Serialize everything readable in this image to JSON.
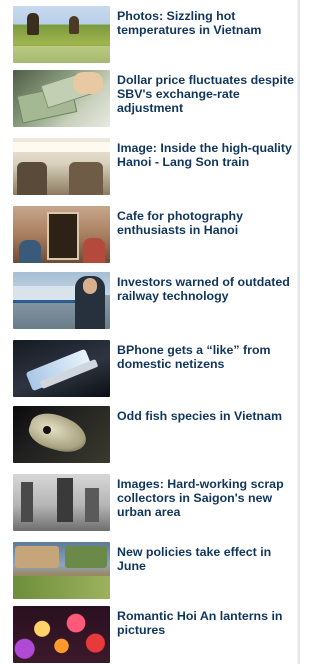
{
  "news": {
    "items": [
      {
        "title": "Photos: Sizzling hot temperatures in Vietnam",
        "thumbnail": "hot-weather-street-photo"
      },
      {
        "title": "Dollar price fluctuates despite SBV's exchange-rate adjustment",
        "thumbnail": "dollar-banknotes-photo"
      },
      {
        "title": "Image: Inside the high-quality Hanoi - Lang Son train",
        "thumbnail": "train-interior-photo"
      },
      {
        "title": "Cafe for photography enthusiasts in Hanoi",
        "thumbnail": "cafe-interior-photo"
      },
      {
        "title": "Investors warned of outdated railway technology",
        "thumbnail": "railway-station-speaker-photo"
      },
      {
        "title": "BPhone gets a “like” from domestic netizens",
        "thumbnail": "smartphone-photo"
      },
      {
        "title": "Odd fish species in Vietnam",
        "thumbnail": "fish-closeup-photo"
      },
      {
        "title": "Images: Hard-working scrap collectors in Saigon's new urban area",
        "thumbnail": "urban-area-photo"
      },
      {
        "title": "New policies take effect in June",
        "thumbnail": "policy-collage-photo"
      },
      {
        "title": "Romantic Hoi An lanterns in pictures",
        "thumbnail": "lanterns-photo"
      }
    ]
  }
}
